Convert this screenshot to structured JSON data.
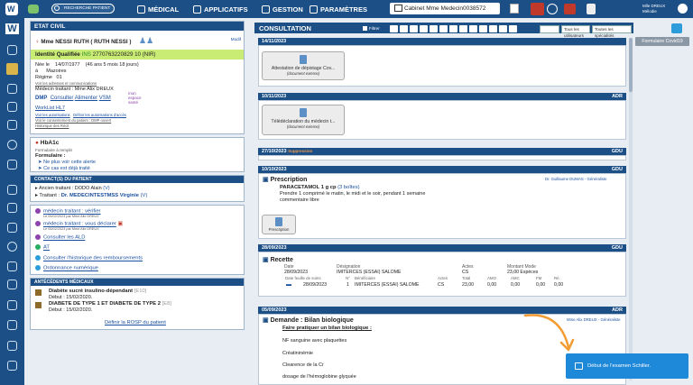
{
  "topbar": {
    "search_placeholder": "RECHERCHE PATIENT",
    "nav": [
      "MÉDICAL",
      "APPLICATIFS",
      "GESTION",
      "PARAMÈTRES"
    ],
    "cabinet": "Cabinet Mme Medecin0038572",
    "user": "Mlle DREUX Mélodie"
  },
  "left": {
    "etat_civil": {
      "title": "ETAT CIVIL",
      "modif": "Modif",
      "patient": "Mme NESSI RUTH ( RUTH NESSI )",
      "identite": "Identité Qualifiée",
      "ins_label": "INS",
      "ins": "2770763220829 10 (NIR)",
      "nee_label": "Née le",
      "nee": "14/07/1977",
      "age": "(46 ans 5 mois 18 jours)",
      "a_label": "à",
      "a": "Mazoires",
      "regime_label": "Régime",
      "regime": "01",
      "adresses": "Voir les adresses et communications",
      "medecin": "Médecin traitant : Mme Alix DREUX",
      "dmp": "DMP",
      "dmp_links": [
        "Consulter",
        "Alimenter",
        "VSM"
      ],
      "mon_espace": "mon espace santé",
      "worklist": "WorkList HL7",
      "autorisations": [
        "Voir les autorisations",
        "Définir les autorisations d'accès"
      ],
      "consentement": "Voir le consentement du patient : DMP ouvert",
      "historique": "Historique des Récit"
    },
    "hba1c": {
      "title": "HbA1c",
      "sub": "Formulaire à remplir",
      "formulaire": "Formulaire :",
      "items": [
        "Ne plus voir cette alerte",
        "Ce cas est déjà traité"
      ]
    },
    "contacts": {
      "title": "CONTACT(S) DU PATIENT",
      "ancien": "Ancien traitant : DODO Alain",
      "ancien_suffix": "(V)",
      "traitant_label": "Traitant :",
      "traitant": "Dr. MEDECINTESTMSS Virginie",
      "traitant_suffix": "(V)"
    },
    "actions": [
      {
        "label": "médecin traitant : vérifier",
        "sub": "Le 05/02/2023 par Mme Alix DREUX",
        "color": "#8e44ad"
      },
      {
        "label": "médecin traitant : vous déclarer",
        "sub": "Le 05/02/2023 par Mme Alix DREUX",
        "color": "#8e44ad"
      },
      {
        "label": "Consulter les ALD",
        "sub": "",
        "color": "#8e44ad"
      },
      {
        "label": "AT",
        "sub": "",
        "color": "#27ae60"
      },
      {
        "label": "Consulter l'historique des remboursements",
        "sub": "",
        "color": "#2d9cdb"
      },
      {
        "label": "Ordonnance numérique",
        "sub": "",
        "color": "#2d9cdb"
      }
    ],
    "antecedents": {
      "title": "ANTÉCÉDENTS MÉDICAUX",
      "items": [
        {
          "name": "Diabète sucré insulino-dépendant",
          "code": "[E10]",
          "debut": "Début : 15/02/2020."
        },
        {
          "name": "DIABETE DE TYPE 1 ET DIABETE DE TYPE 2",
          "code": "[E8]",
          "debut": "Début : 15/02/2020."
        }
      ],
      "rosp": "Définir la ROSP du patient"
    }
  },
  "consultation": {
    "title": "CONSULTATION",
    "filter_label": "Filtrer",
    "selects": [
      "",
      "Tous les utilisateurs",
      "Toutes les spécialités"
    ],
    "formulaire_covid": "Formulaire Covid19",
    "entries": [
      {
        "date": "14/11/2023",
        "author": "",
        "doc": "Attestation de dépistage Cov...",
        "doc_sub": "(document externe)"
      },
      {
        "date": "10/11/2023",
        "author": "ADR",
        "doc": "Télédéclaration du médecin t...",
        "doc_sub": "(document externe)"
      },
      {
        "date": "27/10/2023",
        "badge": "Suppression",
        "author": "GDU"
      },
      {
        "date": "10/10/2023",
        "author": "GDU",
        "title": "Prescription",
        "doctor": "Dr. Guillaume DUMAS - Généraliste",
        "drug": "PARACETAMOL 1 g cp",
        "boites": "(3 boîtes)",
        "posologie": "Prendre 1 comprimé le matin, le midi et le soir, pendant 1 semaine",
        "commentaire": "commentaire libre",
        "doc_label": "Prescription"
      },
      {
        "date": "28/09/2023",
        "author": "GDU",
        "title": "Recette",
        "headers": [
          "Date",
          "Désignation",
          "Actes",
          "Montant Mode"
        ],
        "row1": [
          "28/09/2023",
          "IMITERCES (ESSAI) SALOME",
          "CS",
          "23,00 Espèces"
        ],
        "subheaders": [
          "Date feuille de soins",
          "N°",
          "Bénéficiaire",
          "Actes",
          "Total",
          "AMO",
          "AMC",
          "FM",
          "Ré."
        ],
        "row2": [
          "28/09/2023",
          "1",
          "IMITERCES (ESSAI) SALOME",
          "CS",
          "23,00",
          "0,00",
          "0,00",
          "0,00",
          "0,00"
        ]
      },
      {
        "date": "05/09/2023",
        "author": "ADR",
        "title": "Demande : Bilan biologique",
        "doctor": "Mme Alix DREUX - Généraliste",
        "lines": [
          "Faire pratiquer un bilan biologique :",
          "NF sanguine avec plaquettes",
          "Créatininémie",
          "Clearence de la  Cr",
          "dosage de l'hémoglobine glyquée"
        ]
      }
    ]
  },
  "toast": "Début de l'examen Schiller."
}
